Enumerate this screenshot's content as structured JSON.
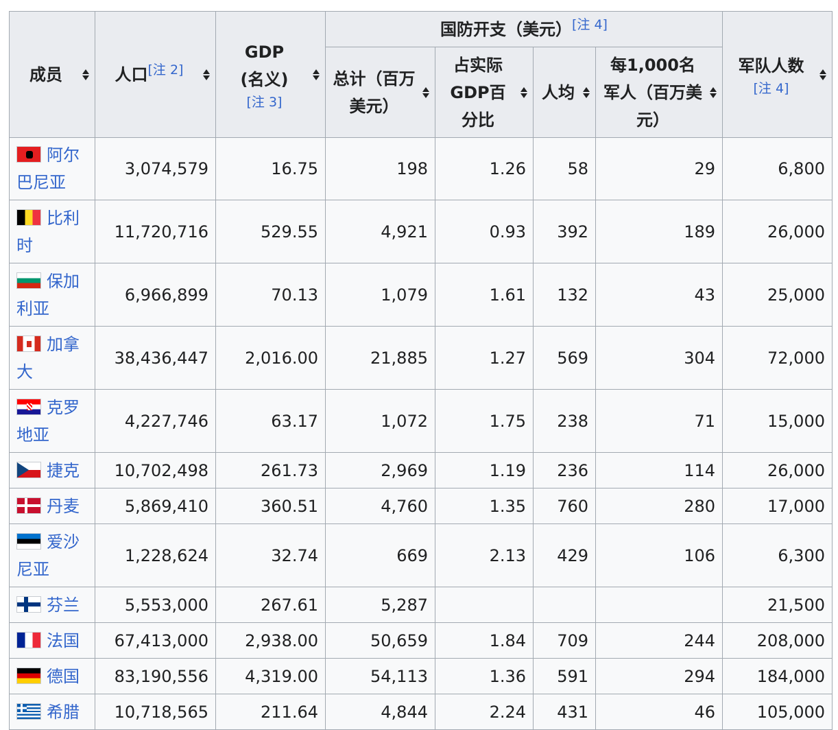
{
  "headers": {
    "member": "成员",
    "population": "人口",
    "population_note": "[注 2]",
    "gdp": "GDP",
    "gdp_sub": "(名义)",
    "gdp_note": "[注 3]",
    "defense": "国防开支（美元）",
    "defense_note": "[注 4]",
    "total": "总计（百万美元）",
    "pct_gdp": "占实际GDP百分比",
    "per_capita": "人均",
    "per_1000": "每1,000名军人（百万美元）",
    "troops": "军队人数",
    "troops_note": "[注 4]"
  },
  "rows": [
    {
      "flag": "albania-flag",
      "name": "阿尔巴尼亚",
      "population": "3,074,579",
      "gdp": "16.75",
      "total": "198",
      "pct": "1.26",
      "per_capita": "58",
      "per_1000": "29",
      "troops": "6,800"
    },
    {
      "flag": "belgium-flag",
      "name": "比利时",
      "population": "11,720,716",
      "gdp": "529.55",
      "total": "4,921",
      "pct": "0.93",
      "per_capita": "392",
      "per_1000": "189",
      "troops": "26,000"
    },
    {
      "flag": "bulgaria-flag",
      "name": "保加利亚",
      "population": "6,966,899",
      "gdp": "70.13",
      "total": "1,079",
      "pct": "1.61",
      "per_capita": "132",
      "per_1000": "43",
      "troops": "25,000"
    },
    {
      "flag": "canada-flag",
      "name": "加拿大",
      "population": "38,436,447",
      "gdp": "2,016.00",
      "total": "21,885",
      "pct": "1.27",
      "per_capita": "569",
      "per_1000": "304",
      "troops": "72,000"
    },
    {
      "flag": "croatia-flag",
      "name": "克罗地亚",
      "population": "4,227,746",
      "gdp": "63.17",
      "total": "1,072",
      "pct": "1.75",
      "per_capita": "238",
      "per_1000": "71",
      "troops": "15,000"
    },
    {
      "flag": "czechia-flag",
      "name": "捷克",
      "population": "10,702,498",
      "gdp": "261.73",
      "total": "2,969",
      "pct": "1.19",
      "per_capita": "236",
      "per_1000": "114",
      "troops": "26,000"
    },
    {
      "flag": "denmark-flag",
      "name": "丹麦",
      "population": "5,869,410",
      "gdp": "360.51",
      "total": "4,760",
      "pct": "1.35",
      "per_capita": "760",
      "per_1000": "280",
      "troops": "17,000"
    },
    {
      "flag": "estonia-flag",
      "name": "爱沙尼亚",
      "population": "1,228,624",
      "gdp": "32.74",
      "total": "669",
      "pct": "2.13",
      "per_capita": "429",
      "per_1000": "106",
      "troops": "6,300"
    },
    {
      "flag": "finland-flag",
      "name": "芬兰",
      "population": "5,553,000",
      "gdp": "267.61",
      "total": "5,287",
      "pct": "",
      "per_capita": "",
      "per_1000": "",
      "troops": "21,500"
    },
    {
      "flag": "france-flag",
      "name": "法国",
      "population": "67,413,000",
      "gdp": "2,938.00",
      "total": "50,659",
      "pct": "1.84",
      "per_capita": "709",
      "per_1000": "244",
      "troops": "208,000"
    },
    {
      "flag": "germany-flag",
      "name": "德国",
      "population": "83,190,556",
      "gdp": "4,319.00",
      "total": "54,113",
      "pct": "1.36",
      "per_capita": "591",
      "per_1000": "294",
      "troops": "184,000"
    },
    {
      "flag": "greece-flag",
      "name": "希腊",
      "population": "10,718,565",
      "gdp": "211.64",
      "total": "4,844",
      "pct": "2.24",
      "per_capita": "431",
      "per_1000": "46",
      "troops": "105,000"
    }
  ]
}
